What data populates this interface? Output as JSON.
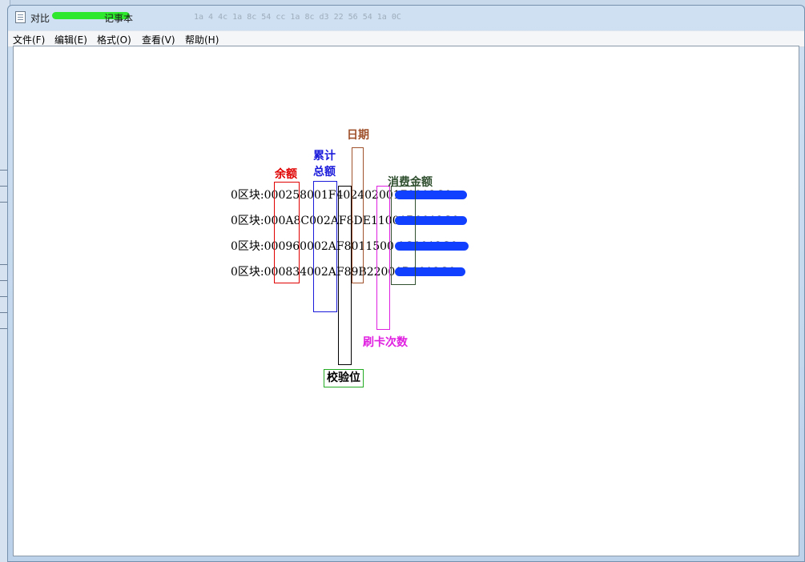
{
  "window": {
    "title_prefix": "对比",
    "title_suffix": "记事本",
    "ghost_text": "1a 4 4c 1a 8c 54 cc 1a 8c d3 22 56 54 1a 0C"
  },
  "menu": {
    "file": "文件(F)",
    "edit": "编辑(E)",
    "format": "格式(O)",
    "view": "查看(V)",
    "help": "帮助(H)"
  },
  "rows": [
    "0区块:000258001F40240200170012C0",
    "0区块:000A8C002AF8DE11001B0012C0",
    "0区块:000960002AF8011500 1C0012C0",
    "0区块:000834002AF89B22001D0012C0"
  ],
  "annotations": {
    "balance": "余额",
    "total_line1": "累计",
    "total_line2": "总额",
    "date": "日期",
    "spend_amount": "消费金额",
    "swipe_count": "刷卡次数",
    "checksum": "校验位"
  },
  "colors": {
    "balance": "#e00000",
    "total": "#1a1adb",
    "date": "#a0522d",
    "spend_amount": "#2f4f2f",
    "swipe_count": "#e020e0",
    "checksum": "#000000",
    "checksum_label_border": "#22aa22",
    "redaction_title": "#2ee82e",
    "redaction_rows": "#1240ff"
  }
}
